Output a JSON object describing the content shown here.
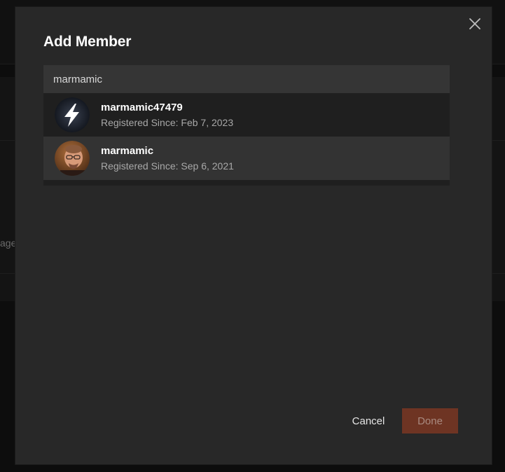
{
  "background": {
    "partial_text": "age"
  },
  "modal": {
    "title": "Add Member",
    "close_icon": "close-icon",
    "search": {
      "value": "marmamic",
      "placeholder": ""
    },
    "results": [
      {
        "username": "marmamic47479",
        "registered": "Registered Since: Feb 7, 2023",
        "avatar": "lightning-bolt-avatar"
      },
      {
        "username": "marmamic",
        "registered": "Registered Since: Sep 6, 2021",
        "avatar": "user-photo-avatar"
      }
    ],
    "cancel_label": "Cancel",
    "done_label": "Done",
    "done_disabled": true
  },
  "colors": {
    "modal_bg": "#282828",
    "search_bg": "#353535",
    "done_bg": "#6e3423",
    "highlight_row": "#333333"
  }
}
